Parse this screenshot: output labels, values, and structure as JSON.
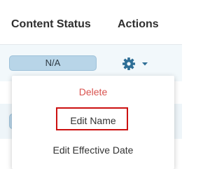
{
  "table": {
    "columns": [
      "Content Status",
      "Actions"
    ]
  },
  "rows": [
    {
      "status": "N/A"
    }
  ],
  "actions_menu": {
    "items": [
      "Delete",
      "Edit Name",
      "Edit Effective Date"
    ],
    "highlighted_item": "Edit Name",
    "colors": {
      "delete": "#d9534f",
      "highlight_border": "#cc1111"
    }
  },
  "icons": {
    "actions_trigger": "gear-icon",
    "caret": "caret-down-icon"
  },
  "colors": {
    "badge_bg": "#b8d5e8",
    "gear": "#2f6f96"
  }
}
